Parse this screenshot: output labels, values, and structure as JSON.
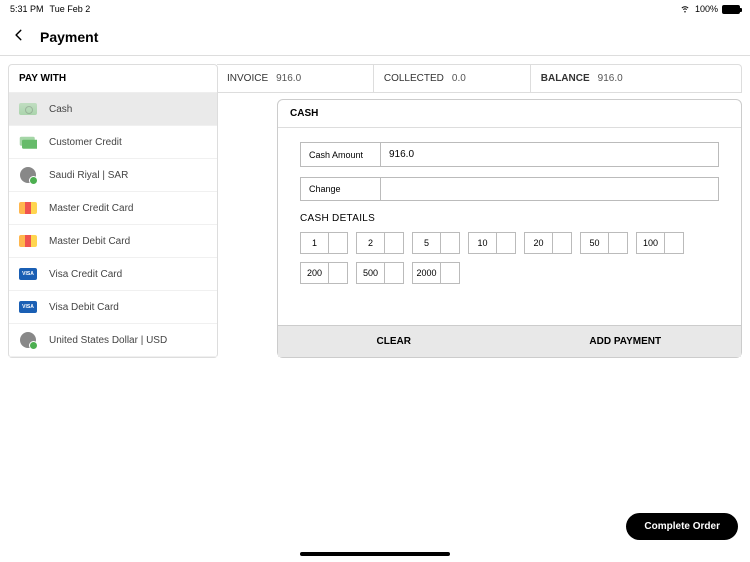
{
  "status": {
    "time": "5:31 PM",
    "date": "Tue Feb 2",
    "battery": "100%"
  },
  "title": "Payment",
  "payWith": {
    "header": "PAY WITH",
    "items": [
      {
        "label": "Cash",
        "icon": "cash",
        "selected": true
      },
      {
        "label": "Customer Credit",
        "icon": "credit",
        "selected": false
      },
      {
        "label": "Saudi Riyal | SAR",
        "icon": "currency",
        "selected": false
      },
      {
        "label": "Master Credit Card",
        "icon": "mastercard",
        "selected": false
      },
      {
        "label": "Master Debit Card",
        "icon": "mastercard",
        "selected": false
      },
      {
        "label": "Visa Credit Card",
        "icon": "visa",
        "selected": false
      },
      {
        "label": "Visa Debit Card",
        "icon": "visa",
        "selected": false
      },
      {
        "label": "United States Dollar | USD",
        "icon": "currency",
        "selected": false
      }
    ]
  },
  "summary": {
    "invoice": {
      "label": "INVOICE",
      "value": "916.0"
    },
    "collected": {
      "label": "COLLECTED",
      "value": "0.0"
    },
    "balance": {
      "label": "BALANCE",
      "value": "916.0"
    }
  },
  "cash": {
    "title": "CASH",
    "amountLabel": "Cash Amount",
    "amountValue": "916.0",
    "changeLabel": "Change",
    "changeValue": "",
    "detailsLabel": "CASH DETAILS",
    "denominations": [
      "1",
      "2",
      "5",
      "10",
      "20",
      "50",
      "100",
      "200",
      "500",
      "2000"
    ],
    "clearLabel": "CLEAR",
    "addLabel": "ADD PAYMENT"
  },
  "completeLabel": "Complete Order",
  "visaText": "VISA"
}
